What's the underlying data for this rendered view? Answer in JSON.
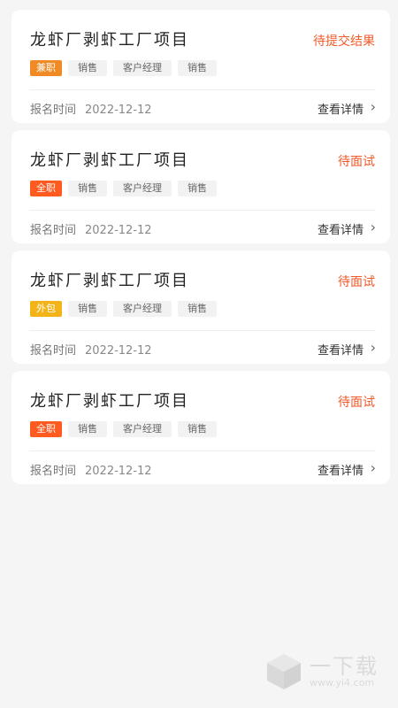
{
  "colors": {
    "accent": "#f05a2a",
    "type_part_time": "#f08a24",
    "type_full_time": "#ff5a1f",
    "type_outsourced": "#f3b41a"
  },
  "cards": [
    {
      "title": "龙虾厂剥虾工厂项目",
      "status": "待提交结果",
      "type": "兼职",
      "type_color": "#f08a24",
      "tags": [
        "销售",
        "客户经理",
        "销售"
      ],
      "signup_label": "报名时间",
      "signup_date": "2022-12-12",
      "detail_label": "查看详情"
    },
    {
      "title": "龙虾厂剥虾工厂项目",
      "status": "待面试",
      "type": "全职",
      "type_color": "#ff5a1f",
      "tags": [
        "销售",
        "客户经理",
        "销售"
      ],
      "signup_label": "报名时间",
      "signup_date": "2022-12-12",
      "detail_label": "查看详情"
    },
    {
      "title": "龙虾厂剥虾工厂项目",
      "status": "待面试",
      "type": "外包",
      "type_color": "#f3b41a",
      "tags": [
        "销售",
        "客户经理",
        "销售"
      ],
      "signup_label": "报名时间",
      "signup_date": "2022-12-12",
      "detail_label": "查看详情"
    },
    {
      "title": "龙虾厂剥虾工厂项目",
      "status": "待面试",
      "type": "全职",
      "type_color": "#ff5a1f",
      "tags": [
        "销售",
        "客户经理",
        "销售"
      ],
      "signup_label": "报名时间",
      "signup_date": "2022-12-12",
      "detail_label": "查看详情"
    }
  ],
  "watermark": {
    "brand": "一下载",
    "site": "www.yi4.com",
    "icon": "cube-icon"
  }
}
